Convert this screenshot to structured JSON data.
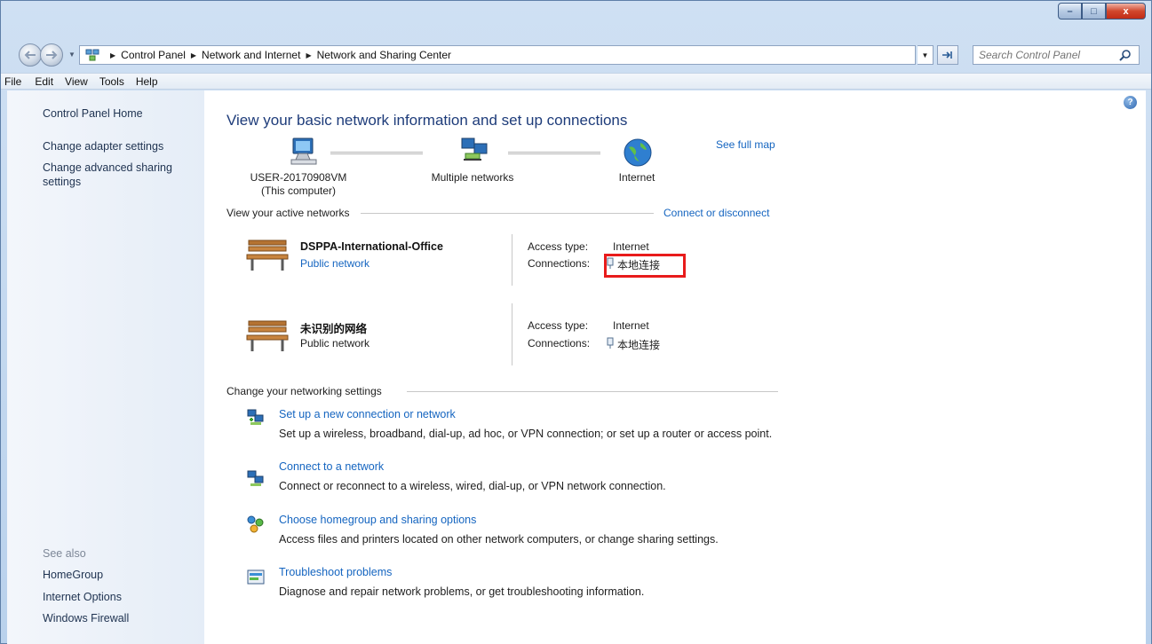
{
  "window": {
    "caption": {
      "minimize": "–",
      "maximize": "□",
      "close": "x"
    }
  },
  "address": {
    "crumbs": [
      "Control Panel",
      "Network and Internet",
      "Network and Sharing Center"
    ],
    "search_placeholder": "Search Control Panel"
  },
  "menu": [
    "File",
    "Edit",
    "View",
    "Tools",
    "Help"
  ],
  "left_pane": {
    "home": "Control Panel Home",
    "links": [
      "Change adapter settings",
      "Change advanced sharing settings"
    ],
    "see_also_label": "See also",
    "see_also": [
      "HomeGroup",
      "Internet Options",
      "Windows Firewall"
    ]
  },
  "main": {
    "title": "View your basic network information and set up connections",
    "see_full_map": "See full map",
    "map": {
      "computer_name": "USER-20170908VM",
      "computer_sub": "(This computer)",
      "middle": "Multiple networks",
      "internet": "Internet"
    },
    "active_header": "View your active networks",
    "connect_disconnect": "Connect or disconnect",
    "networks": [
      {
        "name": "DSPPA-International-Office",
        "type": "Public network",
        "type_is_link": true,
        "access_label": "Access type:",
        "access_value": "Internet",
        "conn_label": "Connections:",
        "conn_value": "本地连接"
      },
      {
        "name": "未识别的网络",
        "type": "Public network",
        "type_is_link": false,
        "access_label": "Access type:",
        "access_value": "Internet",
        "conn_label": "Connections:",
        "conn_value": "本地连接"
      }
    ],
    "change_header": "Change your networking settings",
    "tasks": [
      {
        "icon": "new-connection-icon",
        "title": "Set up a new connection or network",
        "desc": "Set up a wireless, broadband, dial-up, ad hoc, or VPN connection; or set up a router or access point."
      },
      {
        "icon": "connect-network-icon",
        "title": "Connect to a network",
        "desc": "Connect or reconnect to a wireless, wired, dial-up, or VPN network connection."
      },
      {
        "icon": "homegroup-icon",
        "title": "Choose homegroup and sharing options",
        "desc": "Access files and printers located on other network computers, or change sharing settings."
      },
      {
        "icon": "troubleshoot-icon",
        "title": "Troubleshoot problems",
        "desc": "Diagnose and repair network problems, or get troubleshooting information."
      }
    ]
  },
  "colors": {
    "link": "#1565c0",
    "title": "#1e3c7a",
    "highlight": "#e81b1b"
  }
}
